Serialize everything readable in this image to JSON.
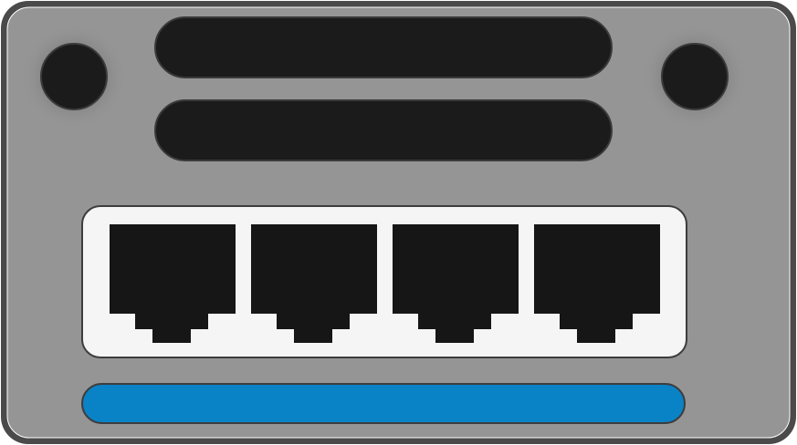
{
  "device": {
    "name": "network-switch-back-panel",
    "body_color": "#959595",
    "outline_color": "#4a4a4a",
    "screw_color": "#1b1b1b",
    "slot_color": "#1b1b1b",
    "port_panel_color": "#f5f5f5",
    "port_color": "#161616",
    "status_bar_color": "#0a82c6",
    "screws": [
      {
        "name": "left-screw-hole-icon"
      },
      {
        "name": "right-screw-hole-icon"
      }
    ],
    "vent_slots": [
      {
        "name": "upper-vent-slot"
      },
      {
        "name": "lower-vent-slot"
      }
    ],
    "ports": [
      {
        "name": "ethernet-port-1-icon"
      },
      {
        "name": "ethernet-port-2-icon"
      },
      {
        "name": "ethernet-port-3-icon"
      },
      {
        "name": "ethernet-port-4-icon"
      }
    ],
    "status_bar": {
      "name": "status-light-bar"
    }
  }
}
